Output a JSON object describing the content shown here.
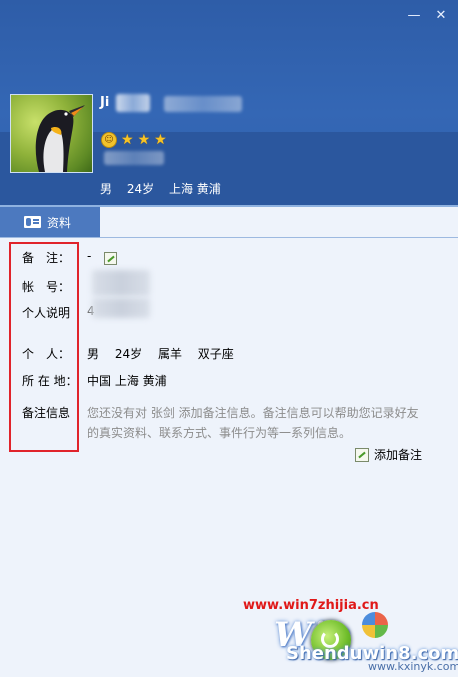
{
  "window": {
    "minimize_glyph": "—",
    "close_glyph": "✕"
  },
  "profile": {
    "nickname_visible": "Ji",
    "brief": [
      "男",
      "24岁",
      "上海 黄浦"
    ]
  },
  "tab": {
    "label": "资料",
    "icon": "id-card-icon"
  },
  "fields": {
    "remark": {
      "label": "备　注：",
      "value": "-"
    },
    "account": {
      "label": "帐　号："
    },
    "signature": {
      "label": "个人说明",
      "value": "4"
    },
    "personal": {
      "label": "个　人：",
      "values": [
        "男",
        "24岁",
        "属羊",
        "双子座"
      ]
    },
    "location": {
      "label": "所 在 地：",
      "value": "中国 上海 黄浦"
    },
    "remark_info": {
      "label": "备注信息",
      "text": "您还没有对 张剑 添加备注信息。备注信息可以帮助您记录好友的真实资料、联系方式、事件行为等一系列信息。"
    }
  },
  "actions": {
    "add_remark": "添加备注"
  },
  "watermark": {
    "url": "www.win7zhijia.cn",
    "win_text": "Win",
    "site": "Shenduwin8.com",
    "site2": "www.kxinyk.com"
  },
  "colors": {
    "header": "#3467b5",
    "tab": "#4c79bf",
    "highlight_box": "#e0232b",
    "notice_text": "#8c8c8c"
  }
}
